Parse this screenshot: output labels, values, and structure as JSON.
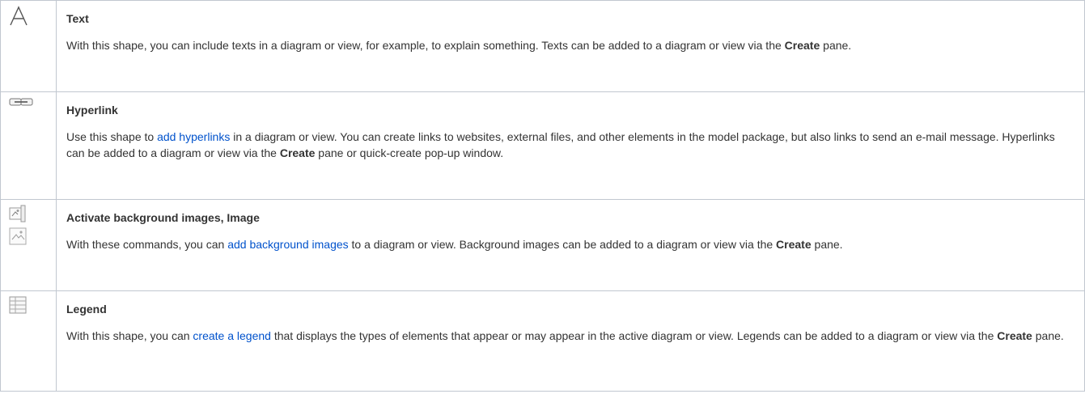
{
  "rows": [
    {
      "icon": "text-a-icon",
      "title": "Text",
      "desc_1": "With this shape, you can include texts in a diagram or view, for example, to explain something. Texts can be added to a diagram or view via the ",
      "desc_bold": "Create",
      "desc_2": " pane."
    },
    {
      "icon": "hyperlink-chain-icon",
      "title": "Hyperlink",
      "desc_1": "Use this shape to ",
      "link": "add hyperlinks",
      "desc_2": " in a diagram or view. You can create links to websites, external files, and other elements in the model package, but also links to send an e-mail message. Hyperlinks can be added to a diagram or view via the ",
      "desc_bold": "Create",
      "desc_3": " pane or quick-create pop-up window."
    },
    {
      "icons": [
        "background-image-icon",
        "image-icon"
      ],
      "title": "Activate background images, Image",
      "desc_1": "With these commands, you can ",
      "link": "add background images",
      "desc_2": " to a diagram or view. Background images can be added to a diagram or view via the ",
      "desc_bold": "Create",
      "desc_3": " pane."
    },
    {
      "icon": "legend-table-icon",
      "title": "Legend",
      "desc_1": "With this shape, you can ",
      "link": "create a legend",
      "desc_2": " that displays the types of elements that appear or may appear in the active diagram or view. Legends can be added to a diagram or view via the ",
      "desc_bold": "Create",
      "desc_3": " pane."
    }
  ]
}
